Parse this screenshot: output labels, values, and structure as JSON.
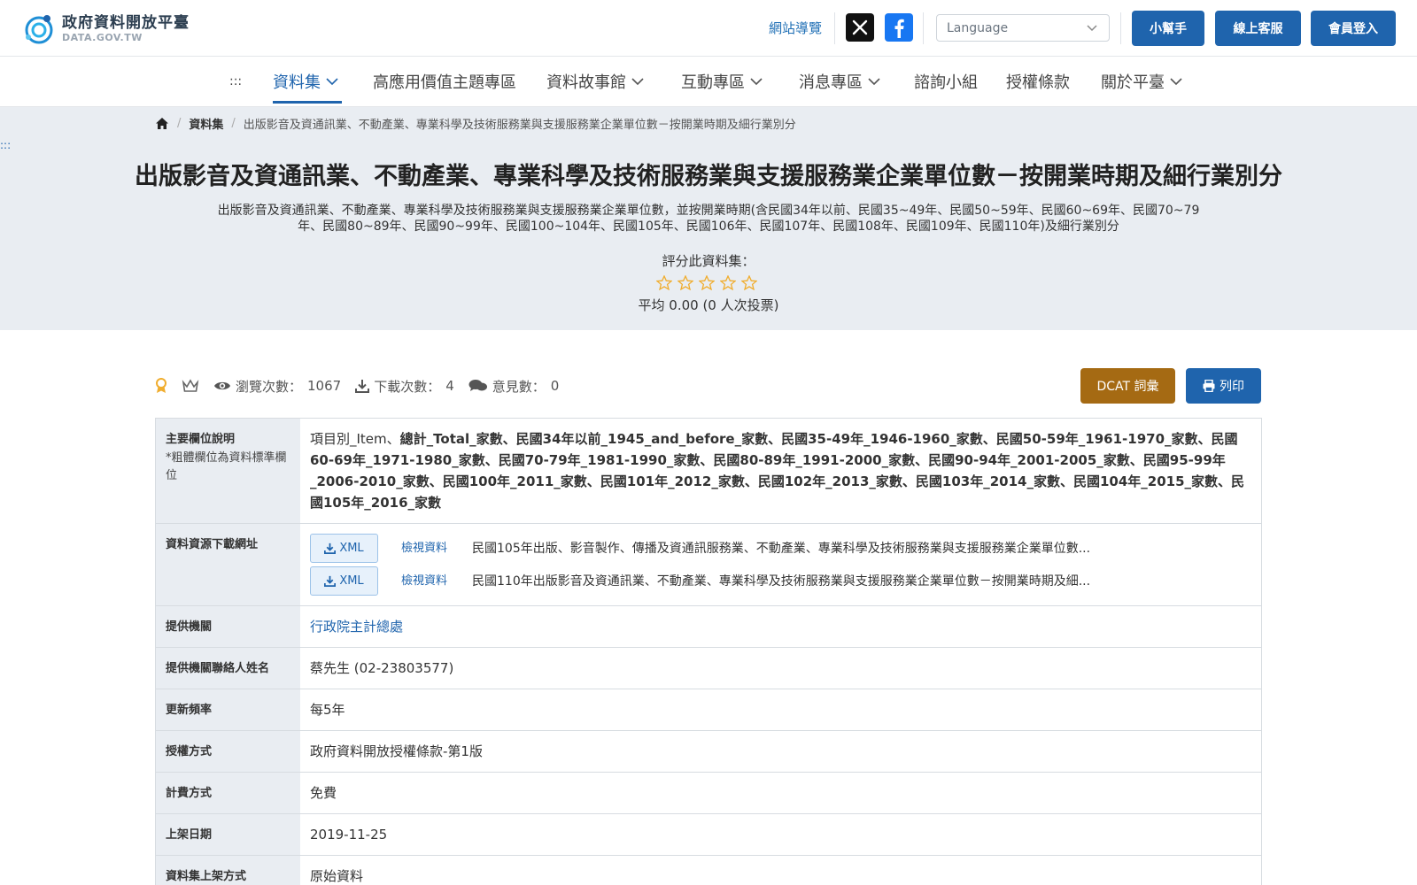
{
  "header": {
    "logo_cn": "政府資料開放平臺",
    "logo_en": "DATA.GOV.TW",
    "sitemap": "網站導覽",
    "language_placeholder": "Language",
    "btn_help": "小幫手",
    "btn_service": "線上客服",
    "btn_login": "會員登入"
  },
  "nav": {
    "dots": ":::",
    "items": [
      "資料集",
      "高應用價值主題專區",
      "資料故事館",
      "互動專區",
      "消息專區",
      "諮詢小組",
      "授權條款",
      "關於平臺"
    ]
  },
  "breadcrumb": {
    "items": [
      "資料集",
      "出版影音及資通訊業、不動產業、專業科學及技術服務業與支援服務業企業單位數－按開業時期及細行業別分"
    ]
  },
  "side_dots": ":::",
  "dataset": {
    "title": "出版影音及資通訊業、不動產業、專業科學及技術服務業與支援服務業企業單位數－按開業時期及細行業別分",
    "description": "出版影音及資通訊業、不動產業、專業科學及技術服務業與支援服務業企業單位數，並按開業時期(含民國34年以前、民國35~49年、民國50~59年、民國60~69年、民國70~79年、民國80~89年、民國90~99年、民國100~104年、民國105年、民國106年、民國107年、民國108年、民國109年、民國110年)及細行業別分",
    "rate_label": "評分此資料集：",
    "rating": 0,
    "avg_text": "平均 0.00 (0 人次投票)"
  },
  "stats": {
    "views_label": "瀏覽次數：",
    "views": "1067",
    "downloads_label": "下載次數：",
    "downloads": "4",
    "comments_label": "意見數：",
    "comments": "0",
    "btn_dcat": "DCAT 詞彙",
    "btn_print": "列印"
  },
  "table": {
    "fields_label": "主要欄位說明",
    "fields_note": "*粗體欄位為資料標準欄位",
    "fields_normal": "項目別_Item、",
    "fields_bold": "總計_Total_家數、民國34年以前_1945_and_before_家數、民國35-49年_1946-1960_家數、民國50-59年_1961-1970_家數、民國60-69年_1971-1980_家數、民國70-79年_1981-1990_家數、民國80-89年_1991-2000_家數、民國90-94年_2001-2005_家數、民國95-99年_2006-2010_家數、民國100年_2011_家數、民國101年_2012_家數、民國102年_2013_家數、民國103年_2014_家數、民國104年_2015_家數、民國105年_2016_家數",
    "resources_label": "資料資源下載網址",
    "resources": [
      {
        "format": "XML",
        "view": "檢視資料",
        "name": "民國105年出版、影音製作、傳播及資通訊服務業、不動產業、專業科學及技術服務業與支援服務業企業單位數..."
      },
      {
        "format": "XML",
        "view": "檢視資料",
        "name": "民國110年出版影音及資通訊業、不動產業、專業科學及技術服務業與支援服務業企業單位數－按開業時期及細..."
      }
    ],
    "agency_label": "提供機關",
    "agency": "行政院主計總處",
    "contact_label": "提供機關聯絡人姓名",
    "contact": "蔡先生 (02-23803577)",
    "frequency_label": "更新頻率",
    "frequency": "每5年",
    "license_label": "授權方式",
    "license": "政府資料開放授權條款-第1版",
    "fee_label": "計費方式",
    "fee": "免費",
    "release_label": "上架日期",
    "release": "2019-11-25",
    "method_label": "資料集上架方式",
    "method": "原始資料"
  },
  "colors": {
    "primary": "#1f64ad",
    "dcat": "#a56a13",
    "hero_bg": "#e9edf2",
    "star": "#f0ad2e"
  }
}
